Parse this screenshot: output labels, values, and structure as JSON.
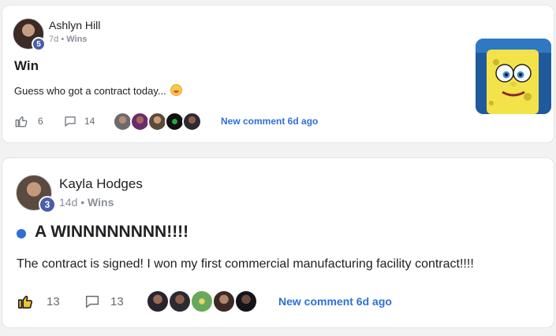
{
  "posts": [
    {
      "author": "Ashlyn Hill",
      "level": "5",
      "age": "7d",
      "category": "Wins",
      "separator": "•",
      "title": "Win",
      "body": "Guess who got a contract today...",
      "body_emoji": "grinning-face-emoji",
      "likes": "6",
      "comments": "14",
      "new_comment": "New comment 6d ago",
      "commenter_avatars": [
        "avatar",
        "avatar",
        "avatar",
        "avatar",
        "avatar"
      ],
      "has_thumbnail": true,
      "liked": false
    },
    {
      "author": "Kayla Hodges",
      "level": "3",
      "age": "14d",
      "category": "Wins",
      "separator": "•",
      "title": "A WINNNNNNNN!!!!",
      "body": "The contract is signed! I won my first commercial manufacturing facility contract!!!!",
      "likes": "13",
      "comments": "13",
      "new_comment": "New comment 6d ago",
      "commenter_avatars": [
        "avatar",
        "avatar",
        "avatar",
        "avatar",
        "avatar"
      ],
      "unread": true,
      "liked": true
    }
  ],
  "colors": {
    "accent": "#2f6fd6",
    "level_badge": "#4a5ea8",
    "muted": "#8a8f98"
  }
}
